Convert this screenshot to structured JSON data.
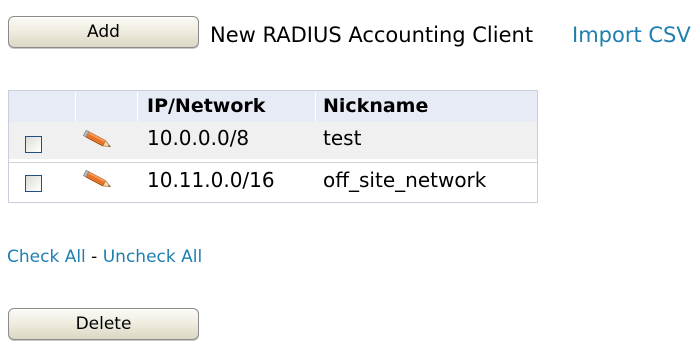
{
  "toolbar": {
    "add_label": "Add",
    "title": "New RADIUS Accounting Client",
    "import_label": "Import CSV"
  },
  "table": {
    "columns": [
      "",
      "",
      "IP/Network",
      "Nickname"
    ],
    "rows": [
      {
        "ip": "10.0.0.0/8",
        "nickname": "test",
        "checked": false
      },
      {
        "ip": "10.11.0.0/16",
        "nickname": "off_site_network",
        "checked": false
      }
    ]
  },
  "selection": {
    "check_all": "Check All",
    "separator": " - ",
    "uncheck_all": "Uncheck All"
  },
  "footer": {
    "delete_label": "Delete"
  },
  "icons": {
    "edit": "pencil-icon",
    "checkbox": "checkbox"
  },
  "colors": {
    "link": "#1e7fb0",
    "header_bg": "#e6ebf5",
    "row_alt_bg": "#f0f0f0",
    "checkbox_border": "#1c5180",
    "pencil_body": "#e8742a",
    "pencil_tip": "#f5d9a8"
  }
}
